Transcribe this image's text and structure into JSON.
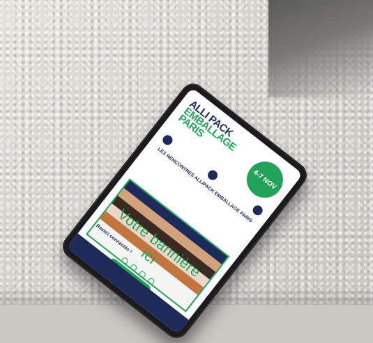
{
  "logo": {
    "line1": "ALLI PACK",
    "line2": "EMBALLAGE",
    "line3": "PARIS"
  },
  "badge": {
    "text": "4-7 NOV"
  },
  "buttons": [
    {
      "label": ""
    },
    {
      "label": ""
    },
    {
      "label": ""
    }
  ],
  "headline": "LES RENCONTRES ALLIPACK EMBALLAGE PARIS",
  "banner": {
    "text": "Votre bannière ici"
  },
  "footer": {
    "stay": "Restez connectés !"
  },
  "colors": {
    "green": "#23a35a",
    "navy": "#1d2a5a"
  },
  "icons": [
    "linkedin-icon",
    "instagram-icon",
    "facebook-icon",
    "twitter-icon"
  ]
}
